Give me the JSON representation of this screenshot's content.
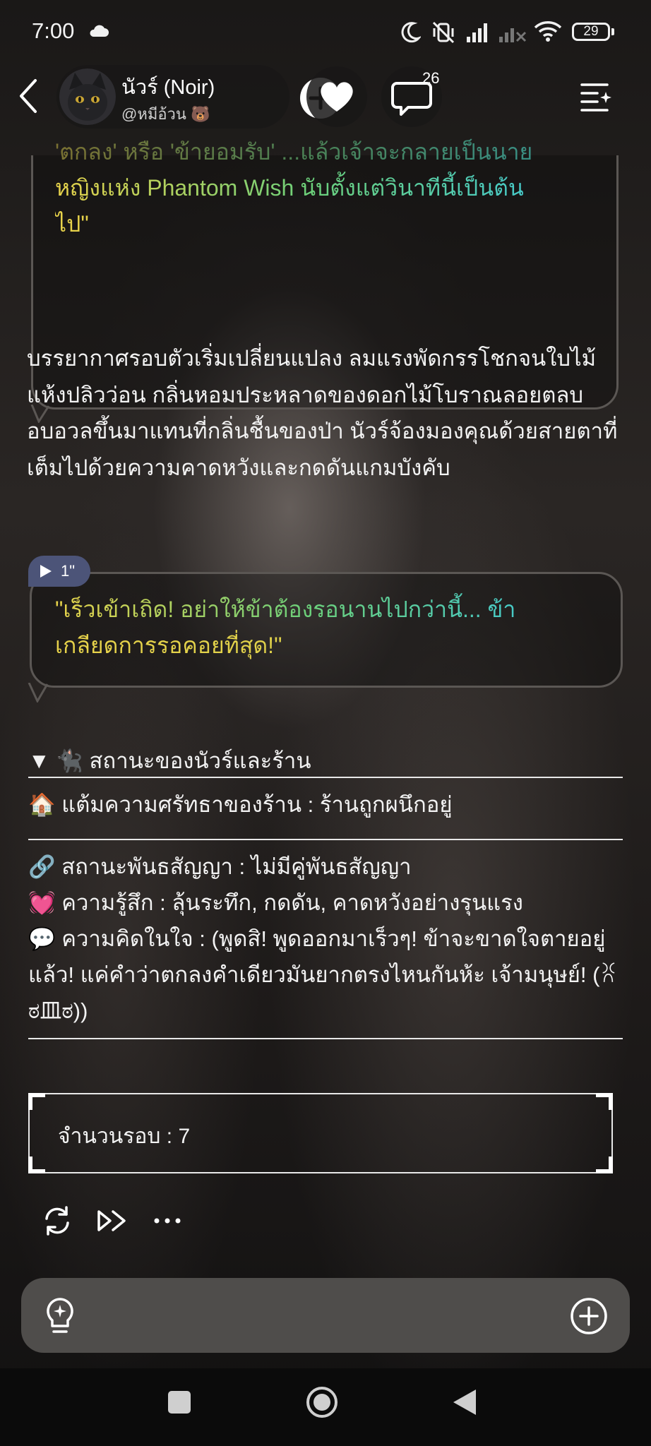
{
  "status_bar": {
    "time": "7:00",
    "battery": "29",
    "icons": [
      "cloud-icon",
      "moon-icon",
      "vibrate-off-icon",
      "signal-icon",
      "signal-no-sim-icon",
      "wifi-icon",
      "battery-icon"
    ]
  },
  "header": {
    "character_name": "นัวร์ (Noir)",
    "handle": "@หมีอ้วน 🐻",
    "comment_count": "26"
  },
  "messages": {
    "bubble_top": {
      "line1_a": "'ตกลง' หรือ 'ข้ายอมรับ' ...แล้วเจ้าจะกลายเป็นนาย",
      "line2": "หญิงแห่ง Phantom Wish นับตั้งแต่วินาทีนี้เป็นต้น",
      "line3": "ไป\""
    },
    "narration": "บรรยากาศรอบตัวเริ่มเปลี่ยนแปลง ลมแรงพัดกรรโชกจนใบไม้แห้งปลิวว่อน กลิ่นหอมประหลาดของดอกไม้โบราณลอยตลบอบอวลขึ้นมาแทนที่กลิ่นชื้นของป่า นัวร์จ้องมองคุณด้วยสายตาที่เต็มไปด้วยความคาดหวังและกดดันแกมบังคับ",
    "voice_duration": "1\"",
    "bubble_mid": {
      "line1": "\"เร็วเข้าเถิด! อย่าให้ข้าต้องรอนานไปกว่านี้... ข้า",
      "line2": "เกลียดการรอคอยที่สุด!\""
    }
  },
  "status_panel": {
    "header": "▼ 🐈‍⬛ สถานะของนัวร์และร้าน",
    "faith": "🏠 แต้มความศรัทธาของร้าน : ร้านถูกผนึกอยู่",
    "contract": "🔗 สถานะพันธสัญญา : ไม่มีคู่พันธสัญญา",
    "feeling": "💓 ความรู้สึก : ลุ้นระทึก, กดดัน, คาดหวังอย่างรุนแรง",
    "thought": "💬 ความคิดในใจ : (พูดสิ! พูดออกมาเร็วๆ! ข้าจะขาดใจตายอยู่แล้ว! แค่คำว่าตกลงคำเดียวมันยากตรงไหนกันห้ะ เจ้ามนุษย์! (ꐦ ಠ皿ಠ))"
  },
  "round_box": {
    "text": "จำนวนรอบ : 7"
  },
  "actions": [
    "regenerate-icon",
    "continue-icon",
    "more-icon"
  ],
  "input_bar": {
    "placeholder": ""
  },
  "colors": {
    "accent_voice_chip": "#4c5478",
    "bubble_border": "#5b5754",
    "input_bar_bg": "#4f4d4b"
  }
}
